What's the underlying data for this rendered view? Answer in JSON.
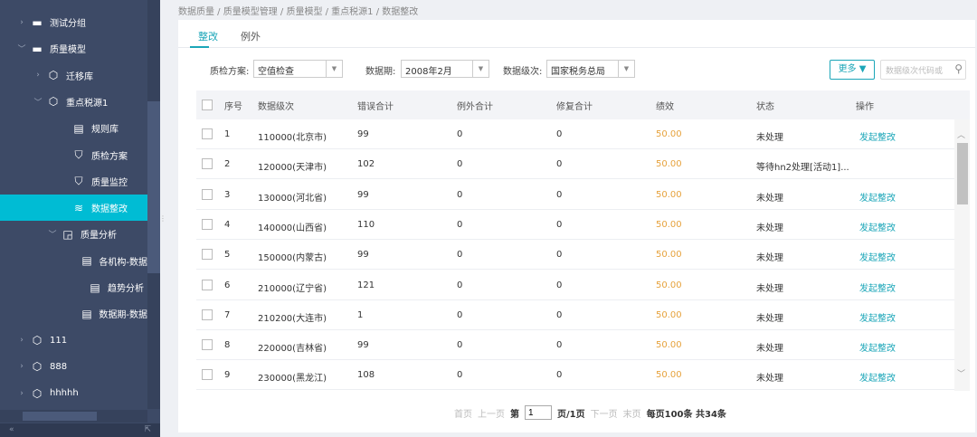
{
  "sidebar": {
    "items": [
      {
        "label": "测试分组",
        "icon": "folder-icon",
        "chev": ">"
      },
      {
        "label": "质量模型",
        "icon": "folder-icon",
        "chev": "v"
      },
      {
        "label": "迁移库",
        "icon": "cube-icon",
        "chev": ">"
      },
      {
        "label": "重点税源1",
        "icon": "cube-icon",
        "chev": "v"
      },
      {
        "label": "规则库",
        "icon": "rule-library-icon",
        "chev": ""
      },
      {
        "label": "质检方案",
        "icon": "shield-doc-icon",
        "chev": ""
      },
      {
        "label": "质量监控",
        "icon": "shield-icon",
        "chev": ""
      },
      {
        "label": "数据整改",
        "icon": "database-edit-icon",
        "chev": ""
      },
      {
        "label": "质量分析",
        "icon": "chart-doc-icon",
        "chev": "v"
      },
      {
        "label": "各机构-数据",
        "icon": "report-icon",
        "chev": ""
      },
      {
        "label": "趋势分析",
        "icon": "report-icon",
        "chev": ""
      },
      {
        "label": "数据期-数据",
        "icon": "report-icon",
        "chev": ""
      },
      {
        "label": "111",
        "icon": "cube-icon",
        "chev": ">"
      },
      {
        "label": "888",
        "icon": "cube-icon",
        "chev": ">"
      },
      {
        "label": "hhhhh",
        "icon": "cube-icon",
        "chev": ">"
      }
    ]
  },
  "breadcrumb": "数据质量 / 质量模型管理 / 质量模型 / 重点税源1 / 数据整改",
  "tabs": [
    "整改",
    "例外"
  ],
  "filters": {
    "plan_label": "质检方案:",
    "plan_value": "空值检查",
    "period_label": "数据期:",
    "period_value": "2008年2月",
    "level_label": "数据级次:",
    "level_value": "国家税务总局",
    "more": "更多 ▼",
    "search_placeholder": "数据级次代码或"
  },
  "table": {
    "headers": [
      "序号",
      "数据级次",
      "错误合计",
      "例外合计",
      "修复合计",
      "绩效",
      "状态",
      "操作"
    ],
    "rows": [
      [
        "1",
        "110000(北京市)",
        "99",
        "0",
        "0",
        "50.00",
        "未处理",
        "发起整改"
      ],
      [
        "2",
        "120000(天津市)",
        "102",
        "0",
        "0",
        "50.00",
        "等待hn2处理[活动1]...",
        ""
      ],
      [
        "3",
        "130000(河北省)",
        "99",
        "0",
        "0",
        "50.00",
        "未处理",
        "发起整改"
      ],
      [
        "4",
        "140000(山西省)",
        "110",
        "0",
        "0",
        "50.00",
        "未处理",
        "发起整改"
      ],
      [
        "5",
        "150000(内蒙古)",
        "99",
        "0",
        "0",
        "50.00",
        "未处理",
        "发起整改"
      ],
      [
        "6",
        "210000(辽宁省)",
        "121",
        "0",
        "0",
        "50.00",
        "未处理",
        "发起整改"
      ],
      [
        "7",
        "210200(大连市)",
        "1",
        "0",
        "0",
        "50.00",
        "未处理",
        "发起整改"
      ],
      [
        "8",
        "220000(吉林省)",
        "99",
        "0",
        "0",
        "50.00",
        "未处理",
        "发起整改"
      ],
      [
        "9",
        "230000(黑龙江)",
        "108",
        "0",
        "0",
        "50.00",
        "未处理",
        "发起整改"
      ]
    ]
  },
  "pager": {
    "first": "首页",
    "prev": "上一页",
    "page_prefix": "第",
    "page": "1",
    "page_suffix": "页/1页",
    "next": "下一页",
    "last": "末页",
    "summary": "每页100条 共34条"
  }
}
